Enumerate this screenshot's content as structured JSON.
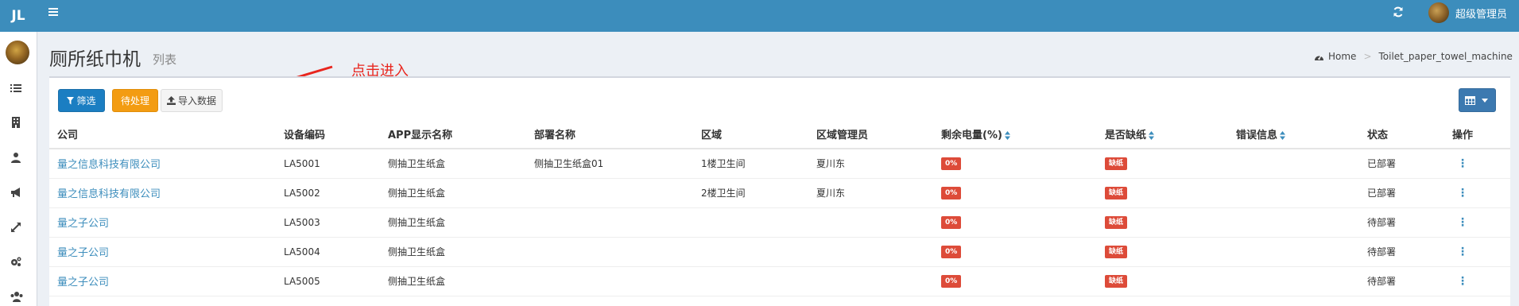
{
  "header": {
    "logo": "JL",
    "user_name": "超级管理员"
  },
  "page": {
    "title": "厕所纸巾机",
    "subtitle": "列表",
    "breadcrumb": [
      "Home",
      "Toilet_paper_towel_machine"
    ]
  },
  "annotation": {
    "text": "点击进入",
    "color": "#e8261e"
  },
  "toolbar": {
    "filter_label": "筛选",
    "pending_label": "待处理",
    "import_label": "导入数据"
  },
  "table": {
    "columns": [
      "公司",
      "设备编码",
      "APP显示名称",
      "部署名称",
      "区域",
      "区域管理员",
      "剩余电量(%)",
      "是否缺纸",
      "错误信息",
      "状态",
      "操作"
    ],
    "rows": [
      {
        "company": "量之信息科技有限公司",
        "code": "LA5001",
        "app_name": "侧抽卫生纸盒",
        "deploy_name": "侧抽卫生纸盒01",
        "area": "1楼卫生间",
        "manager": "夏川东",
        "battery": "0%",
        "paper": "缺纸",
        "error": "",
        "status": "已部署"
      },
      {
        "company": "量之信息科技有限公司",
        "code": "LA5002",
        "app_name": "侧抽卫生纸盒",
        "deploy_name": "",
        "area": "2楼卫生间",
        "manager": "夏川东",
        "battery": "0%",
        "paper": "缺纸",
        "error": "",
        "status": "已部署"
      },
      {
        "company": "量之子公司",
        "code": "LA5003",
        "app_name": "侧抽卫生纸盒",
        "deploy_name": "",
        "area": "",
        "manager": "",
        "battery": "0%",
        "paper": "缺纸",
        "error": "",
        "status": "待部署"
      },
      {
        "company": "量之子公司",
        "code": "LA5004",
        "app_name": "侧抽卫生纸盒",
        "deploy_name": "",
        "area": "",
        "manager": "",
        "battery": "0%",
        "paper": "缺纸",
        "error": "",
        "status": "待部署"
      },
      {
        "company": "量之子公司",
        "code": "LA5005",
        "app_name": "侧抽卫生纸盒",
        "deploy_name": "",
        "area": "",
        "manager": "",
        "battery": "0%",
        "paper": "缺纸",
        "error": "",
        "status": "待部署"
      }
    ]
  },
  "colors": {
    "topbar": "#3c8dbc",
    "link": "#3c8dbc",
    "badge_red": "#dd4b39",
    "btn_primary": "#1b7ec2",
    "btn_warning": "#f39c12"
  },
  "icons": {
    "menu": "hamburger-icon",
    "refresh": "refresh-icon",
    "filter": "filter-icon",
    "upload": "upload-icon",
    "columns": "table-columns-icon",
    "home": "dashboard-icon",
    "sidebar": [
      "list-icon",
      "building-icon",
      "user-icon",
      "bullhorn-icon",
      "expand-icon",
      "cogs-icon",
      "users-icon"
    ]
  }
}
